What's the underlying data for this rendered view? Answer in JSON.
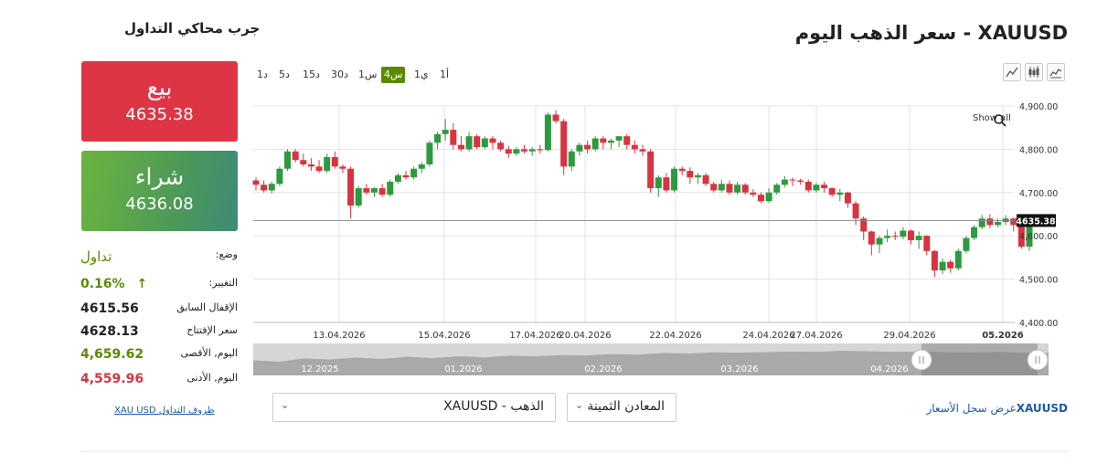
{
  "page_title": "سعر الذهب اليوم - XAUUSD",
  "simulator_title": "جرب محاكي التداول",
  "sell": {
    "label": "بيع",
    "price": "4635.38"
  },
  "buy": {
    "label": "شراء",
    "price": "4636.08"
  },
  "info": {
    "status_label": "وضع:",
    "status_value": "تداول",
    "change_label": "التغيير:",
    "change_value": "0.16%",
    "change_arrow": "↑",
    "prev_close_label": "الإقفال السابق",
    "prev_close_value": "4615.56",
    "open_label": "سعر الإفتتاح",
    "open_value": "4628.13",
    "high_label": "اليوم, الأقصى",
    "high_value": "4,659.62",
    "low_label": "اليوم, الأدنى",
    "low_value": "4,559.96",
    "terms_link": "XAU USD ظروف التداول"
  },
  "timeframes": [
    "1د",
    "5د",
    "15د",
    "30د",
    "1س",
    "4س",
    "1ي",
    "1أ"
  ],
  "active_timeframe": "4س",
  "tools": [
    "line-chart-icon",
    "candlestick-icon",
    "bar-chart-icon"
  ],
  "show_all": "Show all",
  "selects": {
    "instrument": "XAUUSD - الذهب",
    "category": "المعادن الثمينة"
  },
  "history_link": {
    "symbol": "XAUUSD",
    "text": "عرض سجل الأسعار"
  },
  "colors": {
    "up": "#2e9a3f",
    "down": "#d9333f",
    "active": "#5a8a00",
    "sell": "#de3545",
    "buy": "#6cb33f"
  },
  "chart_data": {
    "type": "candlestick",
    "y_ticks": [
      "4,900.00",
      "4,800.00",
      "4,700.00",
      "4,600.00",
      "4,500.00",
      "4,400.00"
    ],
    "ylim": [
      4400,
      4900
    ],
    "x_ticks": [
      "13.04.2026",
      "15.04.2026",
      "17.04.2026",
      "20.04.2026",
      "22.04.2026",
      "24.04.2026",
      "27.04.2026",
      "29.04.2026",
      "05.2026"
    ],
    "current_price": "4635.38",
    "navigator_labels": [
      "12.2025",
      "01.2026",
      "02.2026",
      "03.2026",
      "04.2026"
    ],
    "ohlc": [
      [
        4728,
        4735,
        4705,
        4718
      ],
      [
        4718,
        4728,
        4700,
        4705
      ],
      [
        4705,
        4725,
        4698,
        4720
      ],
      [
        4720,
        4760,
        4715,
        4755
      ],
      [
        4755,
        4800,
        4750,
        4795
      ],
      [
        4795,
        4800,
        4770,
        4775
      ],
      [
        4775,
        4790,
        4760,
        4765
      ],
      [
        4765,
        4780,
        4750,
        4760
      ],
      [
        4760,
        4775,
        4745,
        4750
      ],
      [
        4750,
        4790,
        4745,
        4782
      ],
      [
        4782,
        4795,
        4755,
        4760
      ],
      [
        4760,
        4765,
        4745,
        4755
      ],
      [
        4755,
        4760,
        4640,
        4670
      ],
      [
        4670,
        4715,
        4665,
        4710
      ],
      [
        4710,
        4720,
        4695,
        4700
      ],
      [
        4700,
        4712,
        4690,
        4710
      ],
      [
        4710,
        4720,
        4690,
        4695
      ],
      [
        4695,
        4730,
        4690,
        4725
      ],
      [
        4725,
        4745,
        4720,
        4740
      ],
      [
        4740,
        4750,
        4730,
        4735
      ],
      [
        4735,
        4760,
        4730,
        4755
      ],
      [
        4755,
        4770,
        4745,
        4765
      ],
      [
        4765,
        4820,
        4760,
        4815
      ],
      [
        4815,
        4840,
        4800,
        4835
      ],
      [
        4835,
        4870,
        4820,
        4845
      ],
      [
        4845,
        4860,
        4800,
        4810
      ],
      [
        4810,
        4830,
        4795,
        4800
      ],
      [
        4800,
        4840,
        4795,
        4830
      ],
      [
        4830,
        4835,
        4800,
        4805
      ],
      [
        4805,
        4830,
        4800,
        4825
      ],
      [
        4825,
        4830,
        4800,
        4815
      ],
      [
        4815,
        4820,
        4795,
        4800
      ],
      [
        4800,
        4808,
        4780,
        4790
      ],
      [
        4790,
        4805,
        4785,
        4800
      ],
      [
        4800,
        4810,
        4790,
        4795
      ],
      [
        4795,
        4805,
        4785,
        4800
      ],
      [
        4800,
        4810,
        4790,
        4798
      ],
      [
        4798,
        4885,
        4795,
        4880
      ],
      [
        4880,
        4890,
        4860,
        4865
      ],
      [
        4865,
        4870,
        4740,
        4760
      ],
      [
        4760,
        4800,
        4750,
        4795
      ],
      [
        4795,
        4815,
        4785,
        4810
      ],
      [
        4810,
        4820,
        4790,
        4800
      ],
      [
        4800,
        4830,
        4795,
        4825
      ],
      [
        4825,
        4830,
        4800,
        4815
      ],
      [
        4815,
        4825,
        4800,
        4820
      ],
      [
        4820,
        4830,
        4805,
        4830
      ],
      [
        4830,
        4835,
        4800,
        4810
      ],
      [
        4810,
        4820,
        4790,
        4800
      ],
      [
        4800,
        4810,
        4785,
        4795
      ],
      [
        4795,
        4800,
        4700,
        4710
      ],
      [
        4710,
        4740,
        4690,
        4735
      ],
      [
        4735,
        4745,
        4700,
        4705
      ],
      [
        4705,
        4760,
        4700,
        4755
      ],
      [
        4755,
        4760,
        4740,
        4750
      ],
      [
        4750,
        4758,
        4720,
        4735
      ],
      [
        4735,
        4745,
        4720,
        4740
      ],
      [
        4740,
        4745,
        4715,
        4720
      ],
      [
        4720,
        4725,
        4700,
        4705
      ],
      [
        4705,
        4730,
        4700,
        4720
      ],
      [
        4720,
        4728,
        4695,
        4700
      ],
      [
        4700,
        4725,
        4695,
        4718
      ],
      [
        4718,
        4722,
        4695,
        4700
      ],
      [
        4700,
        4708,
        4690,
        4695
      ],
      [
        4695,
        4700,
        4675,
        4680
      ],
      [
        4680,
        4710,
        4676,
        4700
      ],
      [
        4700,
        4722,
        4695,
        4718
      ],
      [
        4718,
        4738,
        4712,
        4730
      ],
      [
        4730,
        4735,
        4715,
        4728
      ],
      [
        4728,
        4732,
        4718,
        4725
      ],
      [
        4725,
        4730,
        4700,
        4705
      ],
      [
        4705,
        4722,
        4700,
        4718
      ],
      [
        4718,
        4725,
        4700,
        4710
      ],
      [
        4710,
        4712,
        4690,
        4695
      ],
      [
        4695,
        4708,
        4680,
        4700
      ],
      [
        4700,
        4702,
        4665,
        4675
      ],
      [
        4675,
        4680,
        4625,
        4640
      ],
      [
        4640,
        4645,
        4590,
        4610
      ],
      [
        4610,
        4612,
        4555,
        4580
      ],
      [
        4580,
        4600,
        4560,
        4595
      ],
      [
        4595,
        4615,
        4585,
        4600
      ],
      [
        4600,
        4610,
        4590,
        4598
      ],
      [
        4598,
        4620,
        4592,
        4612
      ],
      [
        4612,
        4615,
        4580,
        4590
      ],
      [
        4590,
        4610,
        4570,
        4600
      ],
      [
        4600,
        4602,
        4555,
        4565
      ],
      [
        4565,
        4568,
        4505,
        4520
      ],
      [
        4520,
        4548,
        4512,
        4540
      ],
      [
        4540,
        4545,
        4515,
        4525
      ],
      [
        4525,
        4570,
        4520,
        4565
      ],
      [
        4565,
        4600,
        4560,
        4595
      ],
      [
        4595,
        4625,
        4590,
        4620
      ],
      [
        4620,
        4648,
        4615,
        4640
      ],
      [
        4640,
        4650,
        4618,
        4625
      ],
      [
        4625,
        4640,
        4620,
        4632
      ],
      [
        4632,
        4648,
        4625,
        4640
      ],
      [
        4640,
        4642,
        4610,
        4625
      ],
      [
        4625,
        4630,
        4570,
        4575
      ],
      [
        4575,
        4640,
        4565,
        4635
      ]
    ]
  }
}
